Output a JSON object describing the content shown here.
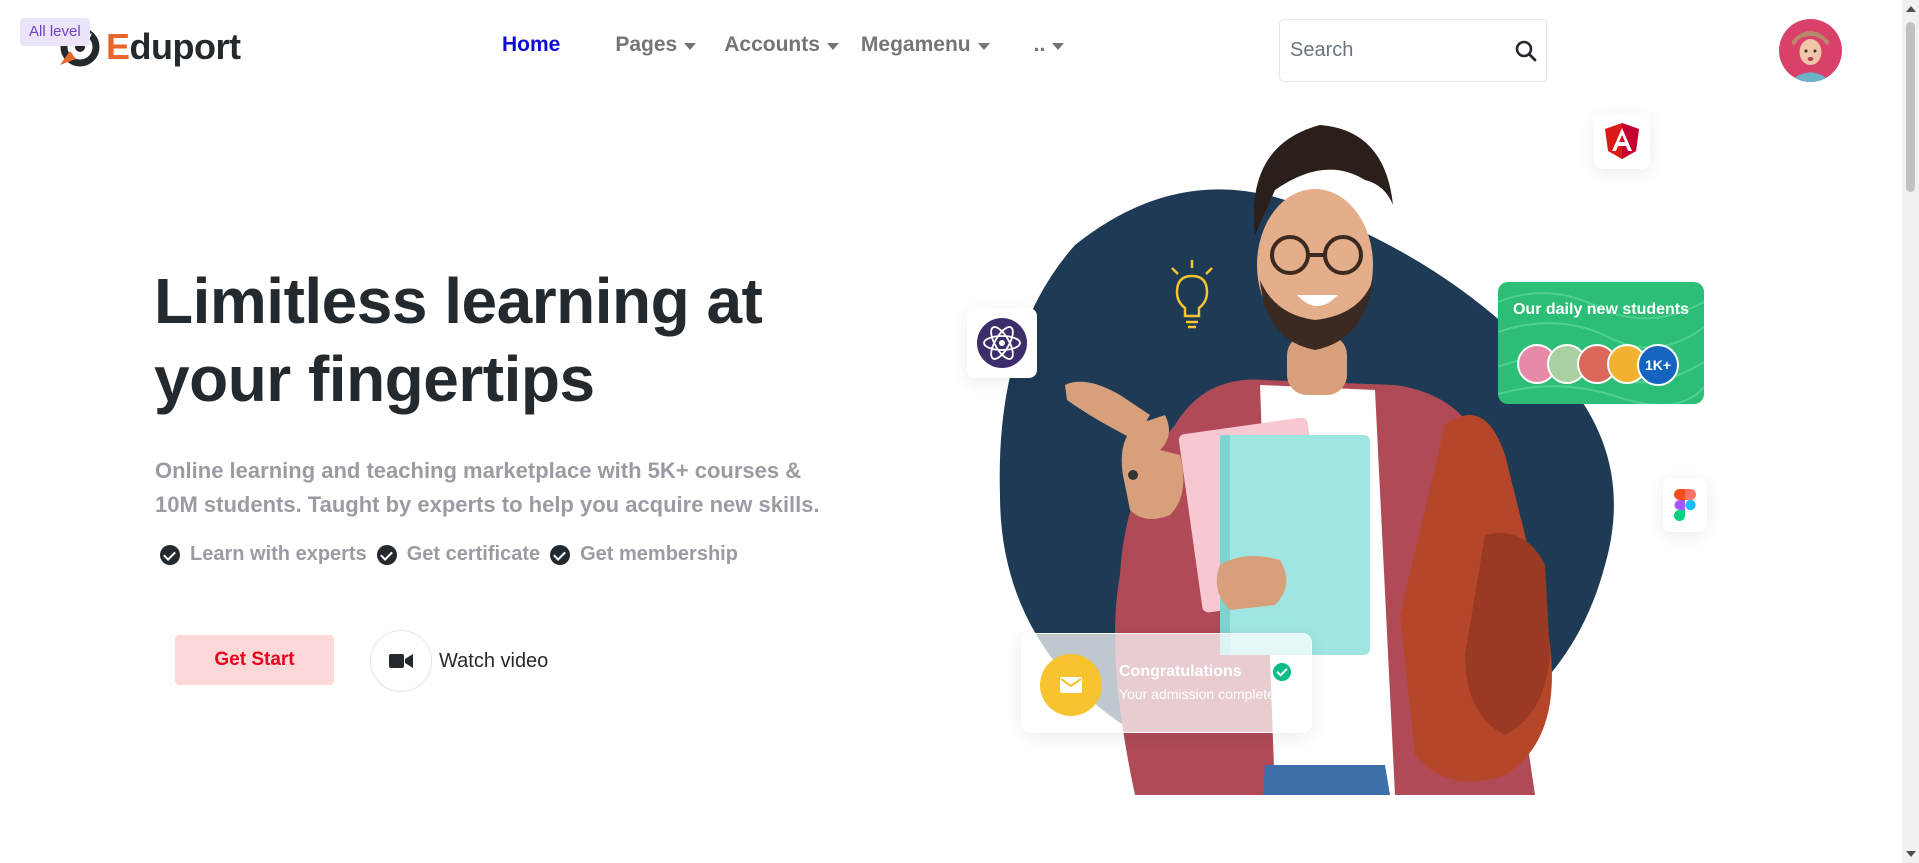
{
  "header": {
    "level_badge": "All level",
    "logo": {
      "first_letter": "E",
      "rest": "duport"
    },
    "nav": [
      {
        "label": "Home",
        "active": true,
        "dropdown": false
      },
      {
        "label": "Pages",
        "active": false,
        "dropdown": true
      },
      {
        "label": "Accounts",
        "active": false,
        "dropdown": true
      },
      {
        "label": "Megamenu",
        "active": false,
        "dropdown": true
      },
      {
        "label": "..",
        "active": false,
        "dropdown": true
      }
    ],
    "search": {
      "placeholder": "Search",
      "value": "",
      "icon": "search-icon"
    },
    "avatar": "user-avatar"
  },
  "hero": {
    "title_line1": "Limitless learning at",
    "title_line2": "your fingertips",
    "subtitle_line1": "Online learning and teaching marketplace with 5K+ courses &",
    "subtitle_line2": "10M students. Taught by experts to help you acquire new skills.",
    "features": [
      "Learn with experts",
      "Get certificate",
      "Get membership"
    ],
    "primary_button": "Get Start",
    "video_link": "Watch video"
  },
  "art": {
    "daily_card": {
      "title": "Our daily new students",
      "count": "1K+"
    },
    "congrats_card": {
      "title": "Congratulations",
      "text": "Your admission completed"
    },
    "floating_icons": [
      "react-atom-icon",
      "angular-icon",
      "figma-icon",
      "lightbulb-icon"
    ]
  },
  "colors": {
    "primary_text": "#24292d",
    "nav_active": "#0d0dd6",
    "muted": "#9a9ca3",
    "brand_orange": "#e8662c",
    "start_button_bg": "#fdd8d8",
    "start_button_text": "#e8001c",
    "blob": "#1e3a55",
    "daily_card": "#2cbd76",
    "congrats_icon": "#f7c32e"
  }
}
